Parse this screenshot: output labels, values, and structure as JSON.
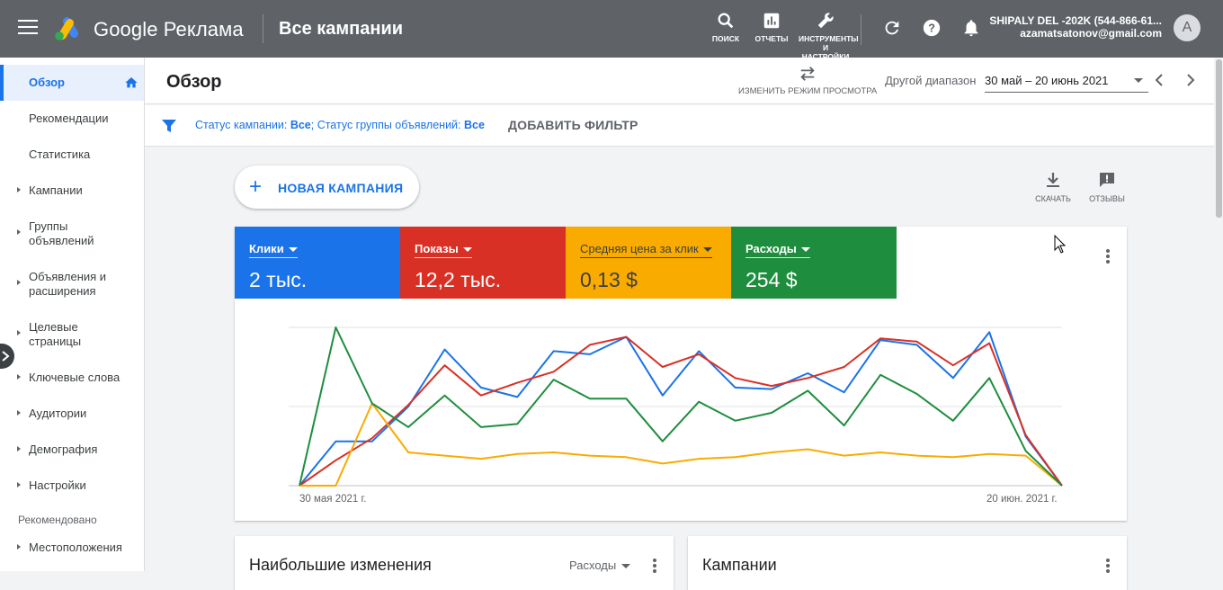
{
  "topbar": {
    "brand": "Google Реклама",
    "page_heading": "Все кампании",
    "tools": {
      "search": "ПОИСК",
      "reports": "ОТЧЕТЫ",
      "tools_line1": "ИНСТРУМЕНТЫ",
      "tools_line2": "И",
      "tools_line3": "НАСТРОЙКИ"
    },
    "account_name": "SHIPALY DEL -202K (544-866-61...",
    "account_email": "azamatsatonov@gmail.com",
    "avatar_letter": "A"
  },
  "sidebar": {
    "items": [
      {
        "label": "Обзор"
      },
      {
        "label": "Рекомендации"
      },
      {
        "label": "Статистика"
      },
      {
        "label": "Кампании"
      },
      {
        "label": "Группы объявлений"
      },
      {
        "label": "Объявления и расширения"
      },
      {
        "label": "Целевые страницы"
      },
      {
        "label": "Ключевые слова"
      },
      {
        "label": "Аудитории"
      },
      {
        "label": "Демография"
      },
      {
        "label": "Настройки"
      }
    ],
    "section_label": "Рекомендовано",
    "extra_item": "Местоположения"
  },
  "header": {
    "title": "Обзор",
    "view_mode": "ИЗМЕНИТЬ РЕЖИМ ПРОСМОТРА",
    "range_label": "Другой диапазон",
    "range_value": "30 май – 20 июнь 2021"
  },
  "filter": {
    "part1": "Статус кампании: ",
    "val1": "Все",
    "part2": "; Статус группы объявлений: ",
    "val2": "Все",
    "add_filter": "ДОБАВИТЬ ФИЛЬТР"
  },
  "actions": {
    "new_campaign": "НОВАЯ КАМПАНИЯ",
    "download": "СКАЧАТЬ",
    "feedback": "ОТЗЫВЫ"
  },
  "metrics": [
    {
      "label": "Клики",
      "value": "2 тыс.",
      "color": "#1a73e8"
    },
    {
      "label": "Показы",
      "value": "12,2 тыс.",
      "color": "#d93025"
    },
    {
      "label": "Средняя цена за клик",
      "value": "0,13 $",
      "color": "#f9ab00"
    },
    {
      "label": "Расходы",
      "value": "254 $",
      "color": "#1e8e3e"
    }
  ],
  "chart_data": {
    "type": "line",
    "x_start_label": "30 мая 2021 г.",
    "x_end_label": "20 июн. 2021 г.",
    "grid": true,
    "normalized": true,
    "series": [
      {
        "name": "Клики",
        "color": "#1a73e8",
        "values": [
          0,
          28,
          28,
          50,
          86,
          62,
          56,
          85,
          83,
          94,
          57,
          85,
          62,
          61,
          71,
          59,
          92,
          89,
          68,
          97,
          31,
          0
        ]
      },
      {
        "name": "Показы",
        "color": "#d93025",
        "values": [
          0,
          16,
          30,
          51,
          76,
          57,
          65,
          72,
          89,
          94,
          75,
          83,
          68,
          63,
          68,
          75,
          93,
          91,
          76,
          90,
          32,
          0
        ]
      },
      {
        "name": "Средняя цена за клик",
        "color": "#f9ab00",
        "values": [
          0,
          0,
          52,
          21,
          19,
          17,
          20,
          21,
          19,
          18,
          14,
          17,
          18,
          21,
          23,
          19,
          21,
          19,
          18,
          20,
          19,
          0
        ]
      },
      {
        "name": "Расходы",
        "color": "#1e8e3e",
        "values": [
          0,
          100,
          52,
          37,
          57,
          37,
          39,
          67,
          55,
          55,
          28,
          53,
          41,
          46,
          60,
          38,
          70,
          58,
          41,
          68,
          22,
          0
        ]
      }
    ]
  },
  "bottom": {
    "card1_title": "Наибольшие изменения",
    "card1_select": "Расходы",
    "card2_title": "Кампании"
  }
}
